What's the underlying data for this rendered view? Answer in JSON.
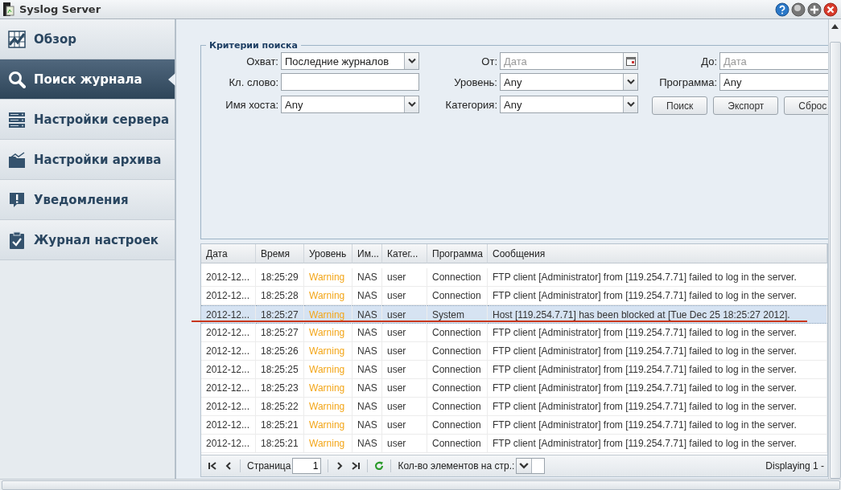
{
  "window": {
    "title": "Syslog Server"
  },
  "sidebar": {
    "items": [
      {
        "label": "Обзор",
        "selected": false
      },
      {
        "label": "Поиск журнала",
        "selected": true
      },
      {
        "label": "Настройки сервера",
        "selected": false
      },
      {
        "label": "Настройки архива",
        "selected": false
      },
      {
        "label": "Уведомления",
        "selected": false
      },
      {
        "label": "Журнал настроек",
        "selected": false
      }
    ]
  },
  "search": {
    "title": "Критерии поиска",
    "fields": [
      {
        "label": "Охват:",
        "kind": "select",
        "value": "Последние журналов"
      },
      {
        "label": "От:",
        "kind": "date",
        "placeholder": "Дата"
      },
      {
        "label": "До:",
        "kind": "cut",
        "placeholder": "Дата"
      },
      {
        "label": "Кл. слово:",
        "kind": "text"
      },
      {
        "label": "Уровень:",
        "kind": "select",
        "value": "Any"
      },
      {
        "label": "Программа:",
        "kind": "cut",
        "value": "Any"
      },
      {
        "label": "Имя хоста:",
        "kind": "select",
        "value": "Any"
      },
      {
        "label": "Категория:",
        "kind": "select",
        "value": "Any"
      }
    ],
    "buttons": [
      "Поиск",
      "Экспорт",
      "Сброс"
    ]
  },
  "table": {
    "columns": [
      "Дата",
      "Время",
      "Уровень",
      "Им...",
      "Катег...",
      "Программа",
      "Сообщения"
    ],
    "rows": [
      {
        "date": "2012-12...",
        "time": "18:25:29",
        "level": "Warning",
        "host": "NAS",
        "category": "user",
        "program": "Connection",
        "message": "FTP client [Administrator] from [119.254.7.71] failed to log in the server.",
        "selected": false
      },
      {
        "date": "2012-12...",
        "time": "18:25:28",
        "level": "Warning",
        "host": "NAS",
        "category": "user",
        "program": "Connection",
        "message": "FTP client [Administrator] from [119.254.7.71] failed to log in the server.",
        "selected": false
      },
      {
        "date": "2012-12...",
        "time": "18:25:27",
        "level": "Warning",
        "host": "NAS",
        "category": "user",
        "program": "System",
        "message": "Host [119.254.7.71] has been blocked at [Tue Dec 25 18:25:27 2012].",
        "selected": true
      },
      {
        "date": "2012-12...",
        "time": "18:25:27",
        "level": "Warning",
        "host": "NAS",
        "category": "user",
        "program": "Connection",
        "message": "FTP client [Administrator] from [119.254.7.71] failed to log in the server.",
        "selected": false
      },
      {
        "date": "2012-12...",
        "time": "18:25:26",
        "level": "Warning",
        "host": "NAS",
        "category": "user",
        "program": "Connection",
        "message": "FTP client [Administrator] from [119.254.7.71] failed to log in the server.",
        "selected": false
      },
      {
        "date": "2012-12...",
        "time": "18:25:25",
        "level": "Warning",
        "host": "NAS",
        "category": "user",
        "program": "Connection",
        "message": "FTP client [Administrator] from [119.254.7.71] failed to log in the server.",
        "selected": false
      },
      {
        "date": "2012-12...",
        "time": "18:25:23",
        "level": "Warning",
        "host": "NAS",
        "category": "user",
        "program": "Connection",
        "message": "FTP client [Administrator] from [119.254.7.71] failed to log in the server.",
        "selected": false
      },
      {
        "date": "2012-12...",
        "time": "18:25:22",
        "level": "Warning",
        "host": "NAS",
        "category": "user",
        "program": "Connection",
        "message": "FTP client [Administrator] from [119.254.7.71] failed to log in the server.",
        "selected": false
      },
      {
        "date": "2012-12...",
        "time": "18:25:21",
        "level": "Warning",
        "host": "NAS",
        "category": "user",
        "program": "Connection",
        "message": "FTP client [Administrator] from [119.254.7.71] failed to log in the server.",
        "selected": false
      },
      {
        "date": "2012-12...",
        "time": "18:25:21",
        "level": "Warning",
        "host": "NAS",
        "category": "user",
        "program": "Connection",
        "message": "FTP client [Administrator] from [119.254.7.71] failed to log in the server.",
        "selected": false
      }
    ]
  },
  "pager": {
    "page_label": "Страница",
    "page": "1",
    "per_page_label": "Кол-во элементов на стр.:",
    "displaying": "Displaying 1 -"
  }
}
